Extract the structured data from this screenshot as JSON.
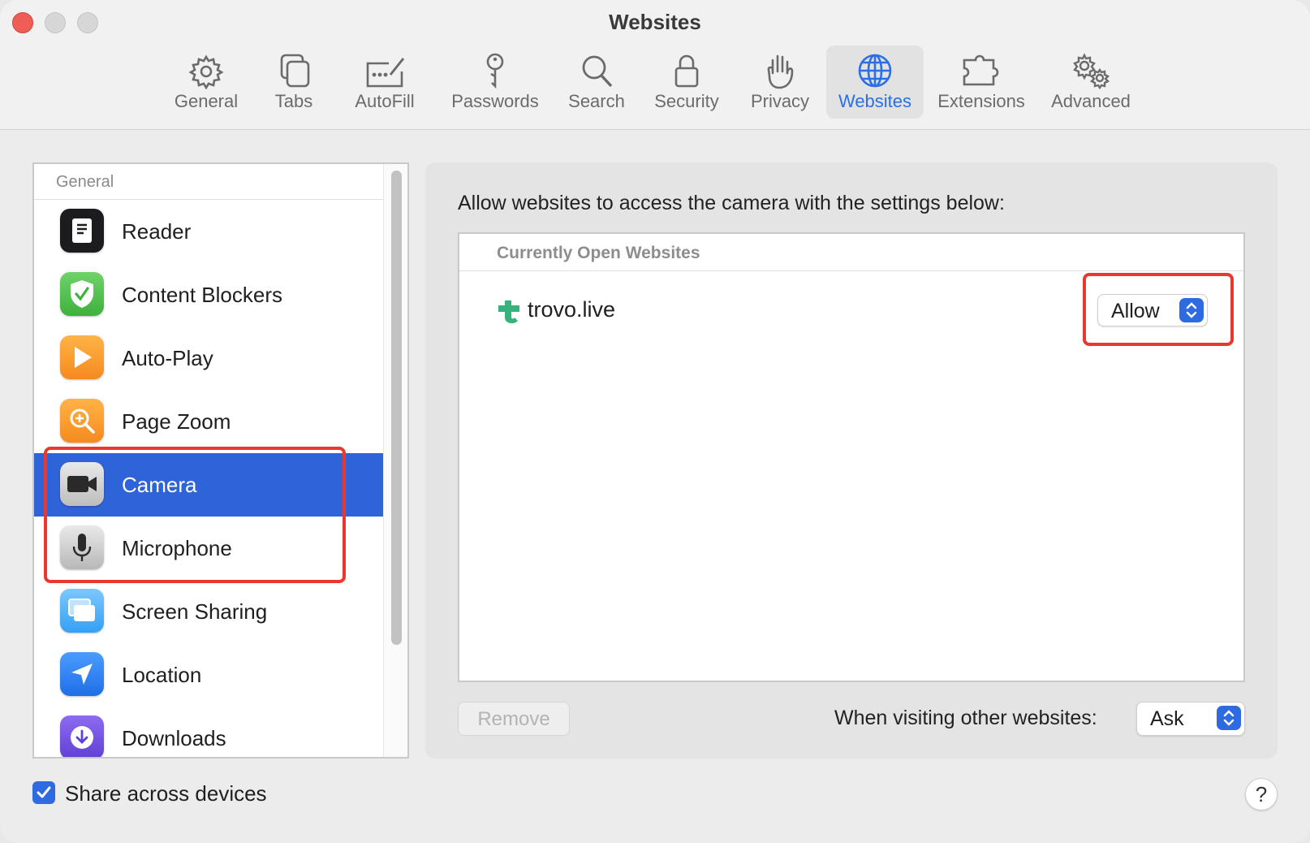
{
  "window": {
    "title": "Websites"
  },
  "toolbar": {
    "items": [
      {
        "label": "General",
        "icon": "gear-icon"
      },
      {
        "label": "Tabs",
        "icon": "tabs-icon"
      },
      {
        "label": "AutoFill",
        "icon": "autofill-icon"
      },
      {
        "label": "Passwords",
        "icon": "key-icon"
      },
      {
        "label": "Search",
        "icon": "magnifier-icon"
      },
      {
        "label": "Security",
        "icon": "lock-icon"
      },
      {
        "label": "Privacy",
        "icon": "hand-icon"
      },
      {
        "label": "Websites",
        "icon": "globe-icon",
        "selected": true
      },
      {
        "label": "Extensions",
        "icon": "puzzle-icon"
      },
      {
        "label": "Advanced",
        "icon": "gears-icon"
      }
    ]
  },
  "sidebar": {
    "section_header": "General",
    "items": [
      {
        "label": "Reader",
        "icon": "reader-icon"
      },
      {
        "label": "Content Blockers",
        "icon": "shield-check-icon"
      },
      {
        "label": "Auto-Play",
        "icon": "play-icon"
      },
      {
        "label": "Page Zoom",
        "icon": "zoom-icon"
      },
      {
        "label": "Camera",
        "icon": "camera-icon",
        "selected": true
      },
      {
        "label": "Microphone",
        "icon": "microphone-icon"
      },
      {
        "label": "Screen Sharing",
        "icon": "screen-sharing-icon"
      },
      {
        "label": "Location",
        "icon": "location-icon"
      },
      {
        "label": "Downloads",
        "icon": "download-icon"
      }
    ]
  },
  "panel": {
    "description": "Allow websites to access the camera with the settings below:",
    "table_header": "Currently Open Websites",
    "sites": [
      {
        "name": "trovo.live",
        "setting": "Allow",
        "icon": "trovo-icon"
      }
    ],
    "remove_label": "Remove",
    "other_websites_label": "When visiting other websites:",
    "other_websites_value": "Ask"
  },
  "footer": {
    "share_label": "Share across devices",
    "share_checked": true,
    "help_label": "?"
  },
  "colors": {
    "accent": "#2f6be0",
    "selection": "#2f63d8",
    "highlight": "#e8392f"
  }
}
